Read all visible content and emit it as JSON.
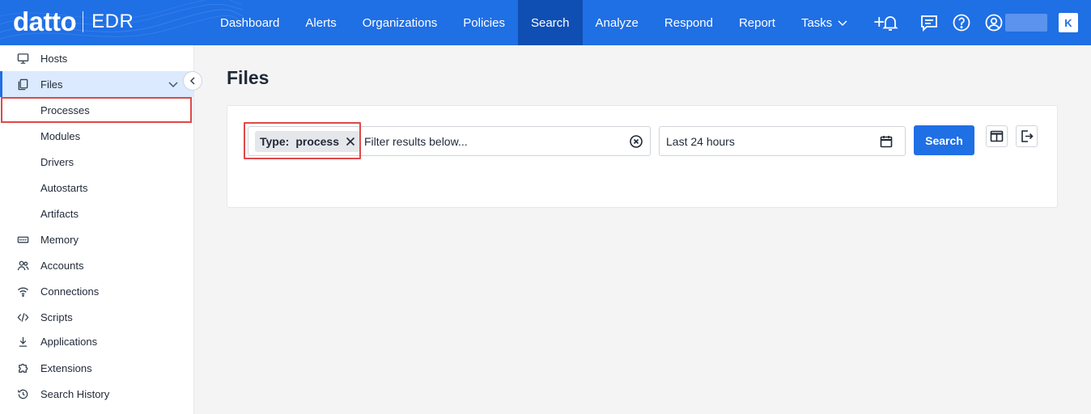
{
  "brand": {
    "logo": "datto",
    "product": "EDR"
  },
  "nav": {
    "items": [
      {
        "label": "Dashboard"
      },
      {
        "label": "Alerts"
      },
      {
        "label": "Organizations"
      },
      {
        "label": "Policies"
      },
      {
        "label": "Search",
        "active": true
      },
      {
        "label": "Analyze"
      },
      {
        "label": "Respond"
      },
      {
        "label": "Report"
      },
      {
        "label": "Tasks"
      }
    ],
    "plus": "+",
    "icons": [
      "bell-icon",
      "chat-icon",
      "help-icon",
      "user-icon"
    ],
    "badge": "K"
  },
  "sidebar": {
    "items": [
      {
        "label": "Hosts",
        "icon": "monitor-icon"
      },
      {
        "label": "Files",
        "icon": "files-icon"
      },
      {
        "label": "Processes"
      },
      {
        "label": "Modules"
      },
      {
        "label": "Drivers"
      },
      {
        "label": "Autostarts"
      },
      {
        "label": "Artifacts"
      },
      {
        "label": "Memory",
        "icon": "memory-icon"
      },
      {
        "label": "Accounts",
        "icon": "accounts-icon"
      },
      {
        "label": "Connections",
        "icon": "wifi-icon"
      },
      {
        "label": "Scripts",
        "icon": "code-icon"
      },
      {
        "label": "Applications",
        "icon": "download-icon"
      },
      {
        "label": "Extensions",
        "icon": "puzzle-icon"
      },
      {
        "label": "Search History",
        "icon": "history-icon"
      }
    ]
  },
  "main": {
    "title": "Files",
    "filter": {
      "chip_key": "Type:",
      "chip_value": "process",
      "placeholder": "Filter results below..."
    },
    "date_range": "Last 24 hours",
    "search_label": "Search"
  },
  "colors": {
    "brand_blue": "#1f6fe5",
    "active_nav": "#0f4fb3",
    "highlight_red": "#e04848",
    "expanded_bg": "#dbeafe"
  }
}
